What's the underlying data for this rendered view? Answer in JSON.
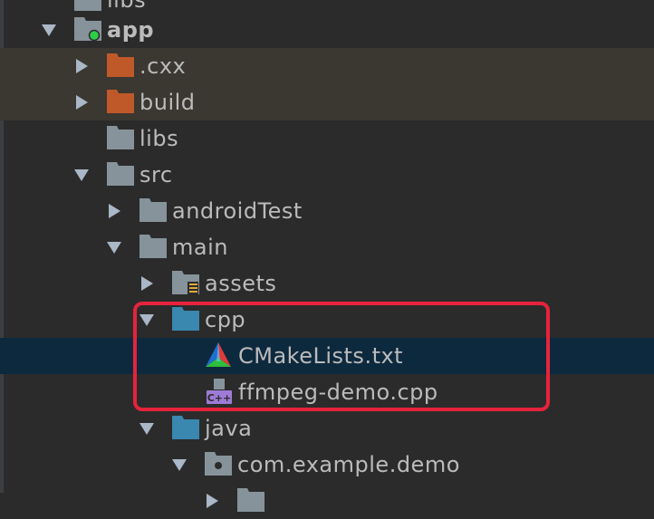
{
  "tree": {
    "top_partial_label": "libs",
    "rows": [
      {
        "id": "app",
        "label": "app",
        "expanded": true,
        "icon": "module-folder-icon"
      },
      {
        "id": "cxx",
        "label": ".cxx",
        "expanded": false,
        "icon": "excluded-folder-icon"
      },
      {
        "id": "build",
        "label": "build",
        "expanded": false,
        "icon": "excluded-folder-icon"
      },
      {
        "id": "libs",
        "label": "libs",
        "icon": "folder-icon"
      },
      {
        "id": "src",
        "label": "src",
        "expanded": true,
        "icon": "folder-icon"
      },
      {
        "id": "androidtest",
        "label": "androidTest",
        "expanded": false,
        "icon": "folder-icon"
      },
      {
        "id": "main",
        "label": "main",
        "expanded": true,
        "icon": "folder-icon"
      },
      {
        "id": "assets",
        "label": "assets",
        "expanded": false,
        "icon": "resources-folder-icon"
      },
      {
        "id": "cpp",
        "label": "cpp",
        "expanded": true,
        "icon": "source-folder-icon"
      },
      {
        "id": "cmakelists",
        "label": "CMakeLists.txt",
        "icon": "cmake-icon",
        "selected": true
      },
      {
        "id": "ffmpeg",
        "label": "ffmpeg-demo.cpp",
        "icon": "cpp-file-icon"
      },
      {
        "id": "java",
        "label": "java",
        "expanded": true,
        "icon": "source-folder-icon"
      },
      {
        "id": "package",
        "label": "com.example.demo",
        "expanded": true,
        "icon": "package-icon"
      }
    ]
  },
  "colors": {
    "background": "#2b2b2b",
    "selected_row": "#0d293e",
    "excluded_row": "#3b3731",
    "folder": "#87939a",
    "excluded_folder": "#c0592a",
    "source_folder": "#3a87b0",
    "module_dot": "#2fcc4b",
    "highlight_box": "#e6233c"
  }
}
